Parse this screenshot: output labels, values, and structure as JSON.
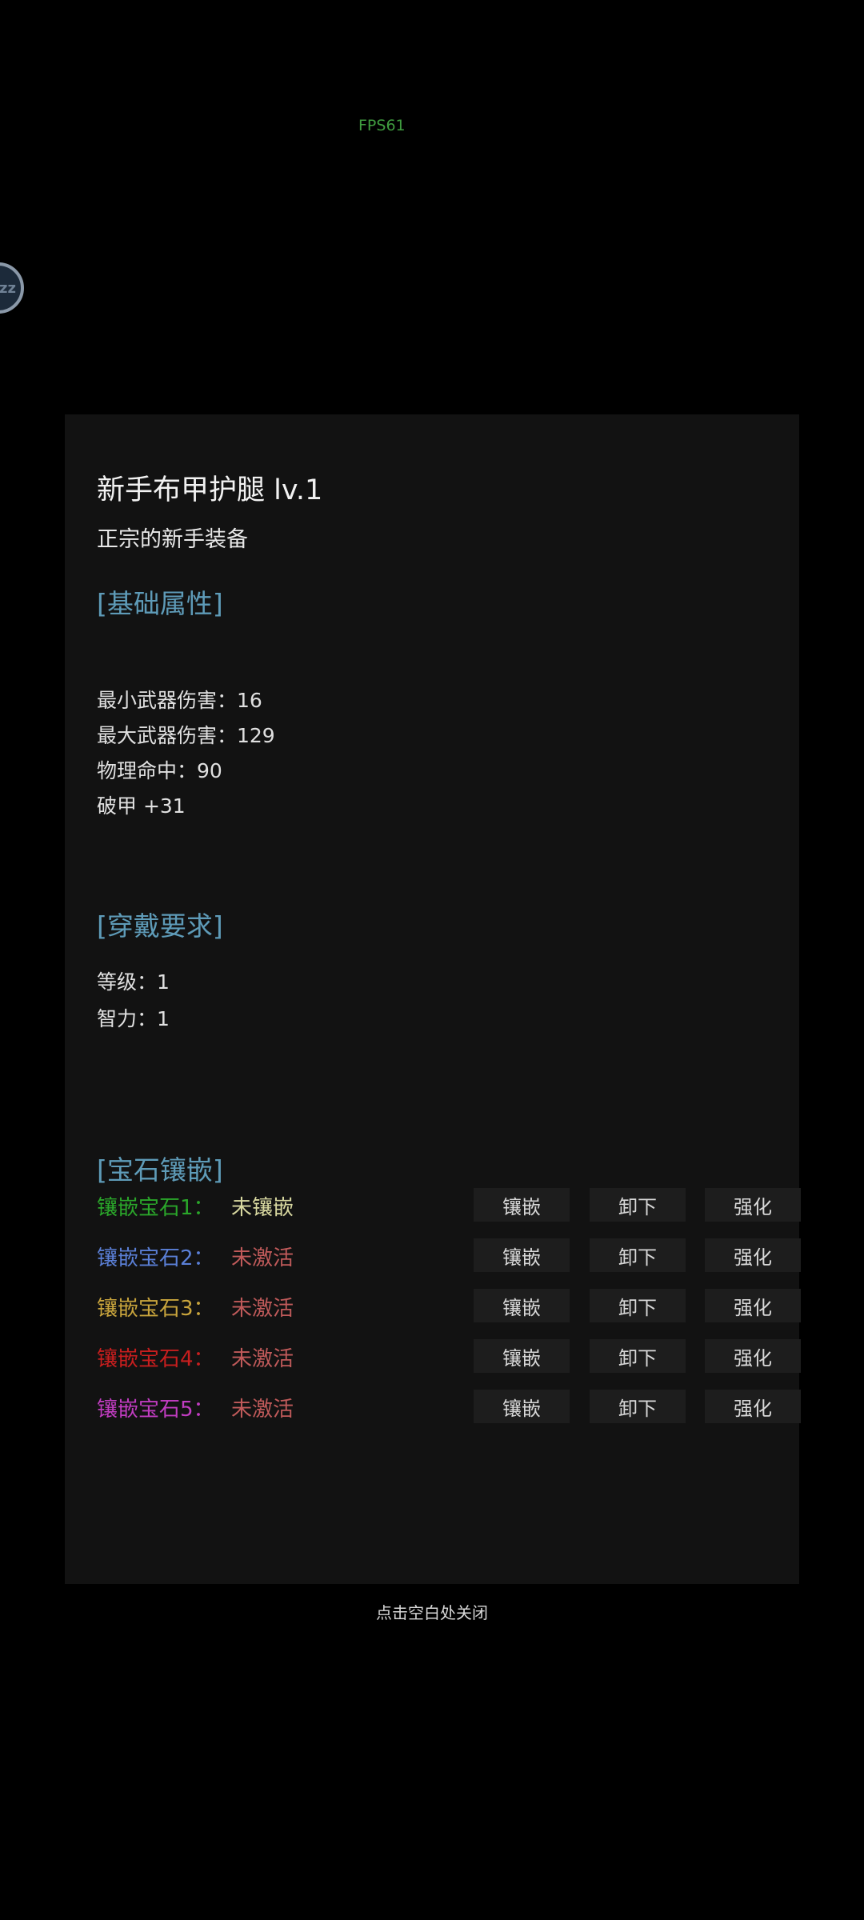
{
  "hud": {
    "fps": "FPS61",
    "float_ball_text": "zz"
  },
  "item": {
    "title": "新手布甲护腿 lv.1",
    "description": "正宗的新手装备"
  },
  "base_attributes": {
    "heading": "[基础属性]",
    "stats": [
      "最小武器伤害：16",
      "最大武器伤害：129",
      "物理命中：90",
      "破甲 +31"
    ]
  },
  "requirements": {
    "heading": "[穿戴要求]",
    "stats": [
      "等级：1",
      "智力：1"
    ]
  },
  "gems": {
    "heading": "[宝石镶嵌]",
    "inlay_label": "镶嵌",
    "remove_label": "卸下",
    "enhance_label": "强化",
    "slots": [
      {
        "label": "镶嵌宝石1：",
        "status": "未镶嵌",
        "label_color": "#2aa62a",
        "status_color": "#d8d8a0"
      },
      {
        "label": "镶嵌宝石2：",
        "status": "未激活",
        "label_color": "#5a7fd6",
        "status_color": "#c05a5a"
      },
      {
        "label": "镶嵌宝石3：",
        "status": "未激活",
        "label_color": "#c8a43c",
        "status_color": "#c05a5a"
      },
      {
        "label": "镶嵌宝石4：",
        "status": "未激活",
        "label_color": "#c81e1e",
        "status_color": "#c05a5a"
      },
      {
        "label": "镶嵌宝石5：",
        "status": "未激活",
        "label_color": "#c03cc0",
        "status_color": "#c05a5a"
      }
    ]
  },
  "close_hint": "点击空白处关闭",
  "colors": {
    "section_heading": "#5e9bb8",
    "panel_bg": "#121212",
    "button_bg": "#1d1d1d"
  }
}
